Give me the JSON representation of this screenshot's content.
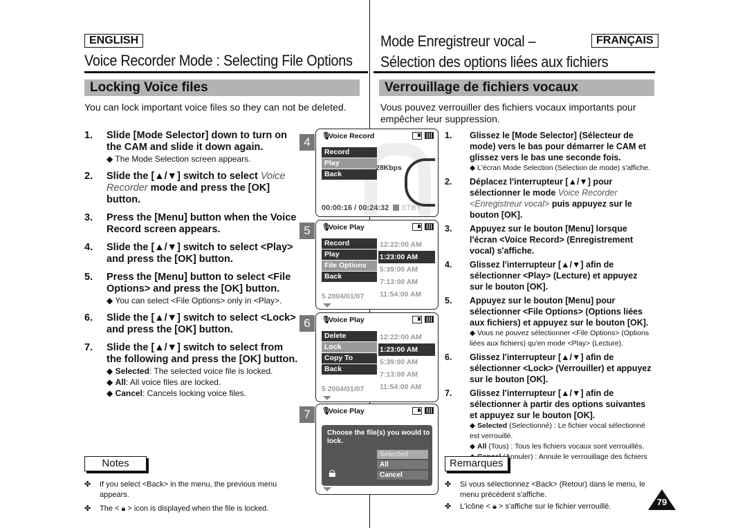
{
  "header": {
    "lang_en": "ENGLISH",
    "lang_fr": "FRANÇAIS",
    "title_en": "Voice Recorder Mode : Selecting File Options",
    "title_fr_line1": "Mode Enregistreur vocal –",
    "title_fr_line2": "Sélection des options liées aux fichiers"
  },
  "english": {
    "section_title": "Locking Voice files",
    "intro": "You can lock important voice files so they can not be deleted.",
    "steps": [
      {
        "num": "1.",
        "text": "Slide [Mode Selector] down to turn on the CAM and slide it down again.",
        "sub": "The Mode Selection screen appears."
      },
      {
        "num": "2.",
        "text_a": "Slide the [▲/▼] switch to select ",
        "text_italic": "Voice Recorder",
        "text_b": " mode and press the [OK] button."
      },
      {
        "num": "3.",
        "text": "Press the [Menu] button when the Voice Record screen appears."
      },
      {
        "num": "4.",
        "text": "Slide the [▲/▼] switch to select <Play> and press the [OK] button."
      },
      {
        "num": "5.",
        "text": "Press the [Menu] button to select <File Options> and press the [OK] button.",
        "sub": "You can select <File Options> only in <Play>."
      },
      {
        "num": "6.",
        "text": "Slide the [▲/▼] switch to select <Lock> and press the [OK] button."
      },
      {
        "num": "7.",
        "text": "Slide the [▲/▼] switch to select from the following and press the [OK] button.",
        "subs": [
          {
            "term": "Selected",
            "desc": ": The selected voice file is locked."
          },
          {
            "term": "All",
            "desc": ": All voice files are locked."
          },
          {
            "term": "Cancel",
            "desc": ": Cancels locking voice files."
          }
        ]
      }
    ],
    "notes_label": "Notes",
    "notes": [
      "If you select <Back> in the menu, the previous menu appears.",
      {
        "before": "The <",
        "after": "> icon is displayed when the file is locked."
      }
    ]
  },
  "screens": [
    {
      "step": "4",
      "title": "Voice Record",
      "menu": [
        "Record",
        "Play",
        "Back"
      ],
      "selected": 1,
      "bitrate": "28Kbps",
      "time": "00:00:16 / 00:24:32",
      "status": "STBY"
    },
    {
      "step": "5",
      "title": "Voice Play",
      "menu": [
        "Record",
        "Play",
        "File Options",
        "Back"
      ],
      "selected": 2,
      "times": [
        "12:22:00 AM",
        "1:23:00 AM",
        "5:39:00 AM",
        "7:13:00 AM",
        "11:54:00 AM"
      ],
      "highlight": 1,
      "row5": "5  2004/01/07"
    },
    {
      "step": "6",
      "title": "Voice Play",
      "menu": [
        "Delete",
        "Lock",
        "Copy To",
        "Back"
      ],
      "selected": 1,
      "times": [
        "12:22:00 AM",
        "1:23:00 AM",
        "5:39:00 AM",
        "7:13:00 AM",
        "11:54:00 AM"
      ],
      "highlight": 1,
      "row5": "5  2004/01/07"
    },
    {
      "step": "7",
      "title": "Voice Play",
      "message": "Choose the file(s) you would to lock.",
      "options": [
        "Selected",
        "All",
        "Cancel"
      ],
      "selected": 0
    }
  ],
  "french": {
    "section_title": "Verrouillage de fichiers vocaux",
    "intro": "Vous pouvez verrouiller des fichiers vocaux importants pour empêcher leur suppression.",
    "steps": [
      {
        "num": "1.",
        "text": "Glissez le [Mode Selector] (Sélecteur de mode) vers le bas pour démarrer le CAM et glissez vers le bas une seconde fois.",
        "sub": "L'écran Mode Selection (Sélection de mode) s'affiche."
      },
      {
        "num": "2.",
        "text_a": "Déplacez l'interrupteur [▲/▼] pour sélectionner le mode ",
        "text_italic": "Voice Recorder <Enregistreur vocal>",
        "text_b": " puis appuyez sur le bouton [OK]."
      },
      {
        "num": "3.",
        "text": "Appuyez sur le bouton [Menu] lorsque l'écran <Voice Record> (Enregistrement vocal) s'affiche."
      },
      {
        "num": "4.",
        "text": "Glissez l'interrupteur [▲/▼] afin de sélectionner <Play> (Lecture) et appuyez sur le bouton [OK]."
      },
      {
        "num": "5.",
        "text": "Appuyez sur le bouton [Menu] pour sélectionner <File Options> (Options liées aux fichiers) et appuyez sur le bouton [OK].",
        "sub": "Vous ne pouvez sélectionner <File Options> (Options liées aux fichiers) qu'en mode <Play> (Lecture)."
      },
      {
        "num": "6.",
        "text": "Glissez l'interrupteur [▲/▼] afin de sélectionner <Lock> (Verrouiller) et appuyez sur le bouton [OK]."
      },
      {
        "num": "7.",
        "text": "Glissez l'interrupteur [▲/▼] afin de sélectionner à partir des options suivantes et appuyez sur le bouton [OK].",
        "subs": [
          {
            "term": "Selected",
            "desc": " (Selectionné) : Le fichier vocal sélectionné est verrouillé."
          },
          {
            "term": "All",
            "desc": " (Tous) : Tous les fichiers vocaux sont verrouillés."
          },
          {
            "term": "Cancel",
            "desc": " (Annuler) : Annule le verrouillage des fichiers vocaux."
          }
        ]
      }
    ],
    "notes_label": "Remarques",
    "notes": [
      "Si vous sélectionnez <Back> (Retour) dans le menu, le menu précédent s'affiche.",
      {
        "before": "L'icône <",
        "after": "> s'affiche sur le fichier verrouillé."
      }
    ]
  },
  "page_number": "79",
  "bullet_diamond": "◆",
  "bullet_note": "✤"
}
